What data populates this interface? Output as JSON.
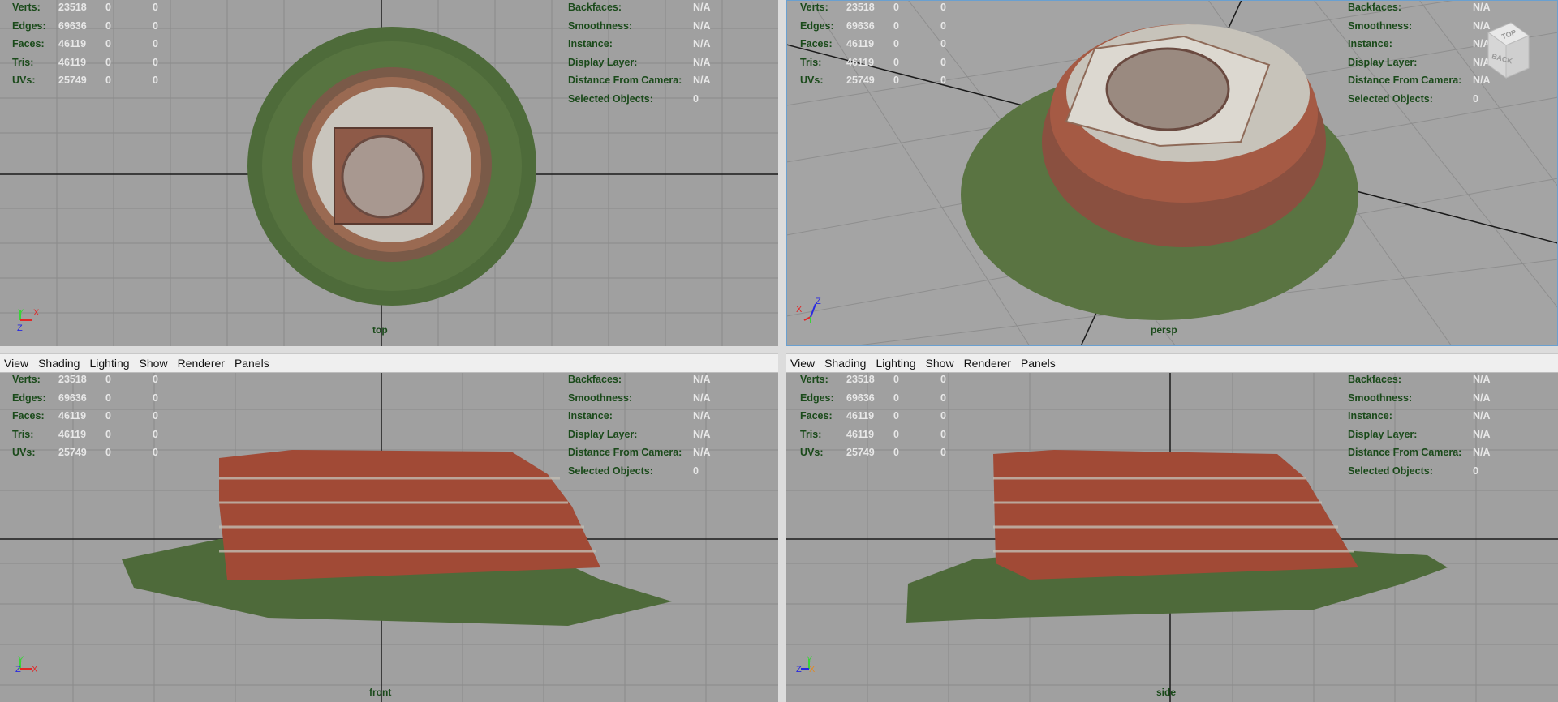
{
  "menu": [
    "View",
    "Shading",
    "Lighting",
    "Show",
    "Renderer",
    "Panels"
  ],
  "hud_left": [
    {
      "label": "Verts:",
      "v1": "23518",
      "v2": "0",
      "v3": "0"
    },
    {
      "label": "Edges:",
      "v1": "69636",
      "v2": "0",
      "v3": "0"
    },
    {
      "label": "Faces:",
      "v1": "46119",
      "v2": "0",
      "v3": "0"
    },
    {
      "label": "Tris:",
      "v1": "46119",
      "v2": "0",
      "v3": "0"
    },
    {
      "label": "UVs:",
      "v1": "25749",
      "v2": "0",
      "v3": "0"
    }
  ],
  "hud_right": [
    {
      "label": "Backfaces:",
      "value": "N/A"
    },
    {
      "label": "Smoothness:",
      "value": "N/A"
    },
    {
      "label": "Instance:",
      "value": "N/A"
    },
    {
      "label": "Display Layer:",
      "value": "N/A"
    },
    {
      "label": "Distance From Camera:",
      "value": "N/A"
    },
    {
      "label": "Selected Objects:",
      "value": "0"
    }
  ],
  "viewports": {
    "top": {
      "camera": "top",
      "axes": [
        "Y",
        "X",
        "Z"
      ]
    },
    "persp": {
      "camera": "persp",
      "axes": [
        "X",
        "Z"
      ],
      "viewcube": [
        "TOP",
        "BACK"
      ]
    },
    "front": {
      "camera": "front",
      "axes": [
        "Y",
        "Z",
        "X"
      ]
    },
    "side": {
      "camera": "side",
      "axes": [
        "Y",
        "Z",
        "X"
      ]
    }
  },
  "colors": {
    "viewport_bg": "#a0a0a0",
    "hud_label": "#1a4a1a",
    "hud_value": "#e8e8e8",
    "brick": "#b5523a",
    "grass": "#4a6a35",
    "concrete": "#c9c5bd"
  }
}
